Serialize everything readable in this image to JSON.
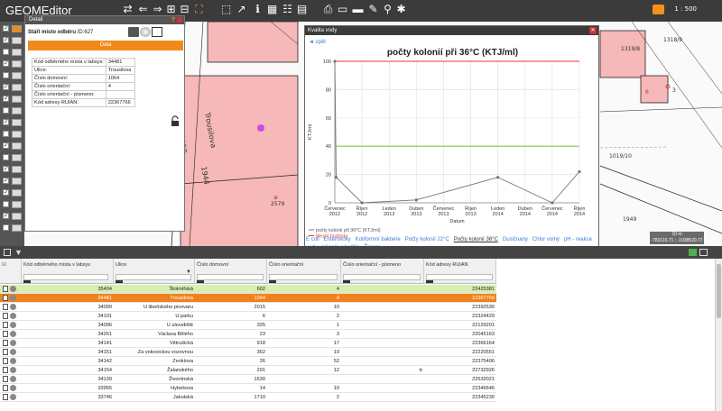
{
  "app": {
    "title": "GEOMEditor",
    "scale_label": "1 : 500"
  },
  "toolbar": {
    "icons": [
      "swap-icon",
      "arrow-left-icon",
      "arrow-right-icon",
      "zoom-in-icon",
      "zoom-out-icon",
      "zoom-extent-icon",
      "select-rect-icon",
      "pointer-icon",
      "info-icon",
      "table-icon",
      "list-icon",
      "print-icon",
      "layers-icon",
      "ruler-icon",
      "pen-icon",
      "search-icon",
      "wrench-icon",
      "chat-icon"
    ]
  },
  "map": {
    "labels": {
      "street_vertical": "Trousilova",
      "house_2579": "2579",
      "house_1944": "1944",
      "h_1319": "1319/8",
      "h_1318": "1318/9",
      "h_1019": "1019/10",
      "h_6": "6",
      "h_3": "3",
      "lbl_1949": "1949",
      "lbl_150": "150"
    },
    "ruler": {
      "top": "10 m",
      "bottom": "-783110.71 ; -1038520.77"
    },
    "accent_red": "#c0272d"
  },
  "detail": {
    "header": "Detail",
    "subtitle": "Stáří místo odběru",
    "id_label": "ID:627",
    "data_tab": "Data",
    "fields": [
      {
        "label": "Kód odběrného místa v labsys:",
        "value": "34481"
      },
      {
        "label": "Ulice:",
        "value": "Trousilova"
      },
      {
        "label": "Číslo domovní:",
        "value": "1064"
      },
      {
        "label": "Číslo orientační:",
        "value": "4"
      },
      {
        "label": "Číslo orientační - písmeno:",
        "value": ""
      },
      {
        "label": "Kód adresy RUIAN:",
        "value": "22367766"
      }
    ]
  },
  "chart_window": {
    "header": "Kvalita vody",
    "back_link": "◄ zpět",
    "tabs": [
      "E coli",
      "Enterokoky",
      "Koliformní bakterie",
      "Počty kolonií 22°C",
      "Počty kolonií 36°C",
      "Dusičnany",
      "Chlor volný",
      "pH - reakce vody",
      "Vápník a hořčík",
      "Železo"
    ],
    "active_tab": "Počty kolonií 36°C"
  },
  "chart_data": {
    "type": "line",
    "title": "počty kolonií při 36°C (KTJ/ml)",
    "xlabel": "Datum",
    "ylabel": "KTJ/ml",
    "ylim": [
      0,
      100
    ],
    "yticks": [
      0,
      20,
      40,
      60,
      80,
      100
    ],
    "categories": [
      "Červenec 2012",
      "Říjen 2012",
      "Leden 2013",
      "Duben 2013",
      "Červenec 2013",
      "Říjen 2013",
      "Leden 2014",
      "Duben 2014",
      "Červenec 2014",
      "Říjen 2014"
    ],
    "series": [
      {
        "name": "počty kolonií při 36°C (KTJ/ml)",
        "color": "#777777",
        "points": [
          [
            0,
            100
          ],
          [
            0.05,
            18
          ],
          [
            1,
            0
          ],
          [
            3,
            2
          ],
          [
            6,
            18
          ],
          [
            8,
            0
          ],
          [
            9,
            22
          ]
        ]
      },
      {
        "name": "Mezní hodnota",
        "color": "#e53935",
        "constant": 100
      },
      {
        "name": "Doporučená hodnota",
        "color": "#8bc34a",
        "constant": 40
      }
    ],
    "grid": true,
    "legend_position": "bottom-left"
  },
  "grid": {
    "columns": [
      "Kód odběrného místa v labsys",
      "Ulice",
      "Číslo domovní",
      "Číslo orientační",
      "Číslo orientační - písmeno",
      "Kód adresy RUIAN"
    ],
    "rows": [
      [
        "35404",
        "Štolmířská",
        "602",
        "4",
        "",
        "22425381"
      ],
      [
        "34481",
        "Trousilova",
        "1064",
        "4",
        "",
        "22367766"
      ],
      [
        "34099",
        "U libeňského pivovaru",
        "2015",
        "10",
        "",
        "22392530"
      ],
      [
        "34101",
        "U parku",
        "6",
        "2",
        "",
        "22324429"
      ],
      [
        "34096",
        "U závodiště",
        "325",
        "1",
        "",
        "22129201"
      ],
      [
        "34261",
        "Václava Bělého",
        "23",
        "3",
        "",
        "22045163"
      ],
      [
        "34141",
        "Větrušická",
        "918",
        "17",
        "",
        "22366164"
      ],
      [
        "34151",
        "Za vokovickou vozovnou",
        "362",
        "19",
        "",
        "22220551"
      ],
      [
        "34142",
        "Zenklova",
        "26",
        "52",
        "",
        "22375406"
      ],
      [
        "34154",
        "Žalanského",
        "291",
        "12",
        "b",
        "22732926"
      ],
      [
        "34139",
        "Živonínská",
        "1630",
        "",
        "",
        "22532021"
      ],
      [
        "33955",
        "Hybešova",
        "14",
        "10",
        "",
        "22346646"
      ],
      [
        "33746",
        "Jakutská",
        "1710",
        "2",
        "",
        "22345230"
      ]
    ],
    "selected_row": 1,
    "highlight_row": 0
  }
}
